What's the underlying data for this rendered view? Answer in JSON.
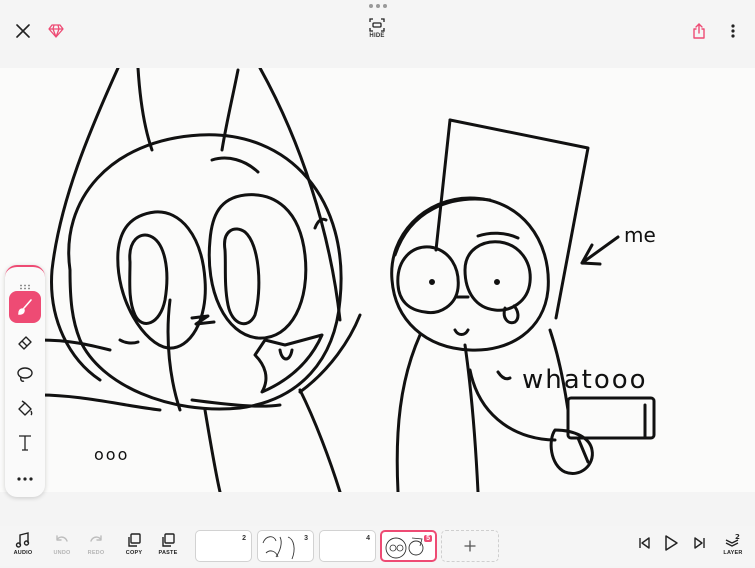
{
  "topbar": {
    "close_icon": "close-icon",
    "premium_icon": "diamond-icon",
    "hide_label": "HIDE",
    "share_icon": "share-icon",
    "menu_icon": "more-vertical-icon"
  },
  "toolbox": {
    "items": [
      {
        "name": "brush",
        "icon": "brush-icon",
        "active": true
      },
      {
        "name": "eraser",
        "icon": "eraser-icon",
        "active": false
      },
      {
        "name": "lasso",
        "icon": "lasso-icon",
        "active": false
      },
      {
        "name": "fill",
        "icon": "fill-bucket-icon",
        "active": false
      },
      {
        "name": "text",
        "icon": "text-icon",
        "active": false
      },
      {
        "name": "more",
        "icon": "more-horizontal-icon",
        "active": false
      }
    ]
  },
  "canvas": {
    "handwriting": {
      "me": "me",
      "what": "whatooo",
      "dots": "ooo"
    }
  },
  "bottombar": {
    "audio_label": "AUDIO",
    "undo_label": "UNDO",
    "redo_label": "REDO",
    "copy_label": "COPY",
    "paste_label": "PASTE",
    "layer_label": "LAYER",
    "layer_count": "2",
    "frames": [
      {
        "number": "2",
        "active": false
      },
      {
        "number": "3",
        "active": false
      },
      {
        "number": "4",
        "active": false
      },
      {
        "number": "5",
        "active": true
      }
    ],
    "accent_color": "#ee4b74"
  }
}
